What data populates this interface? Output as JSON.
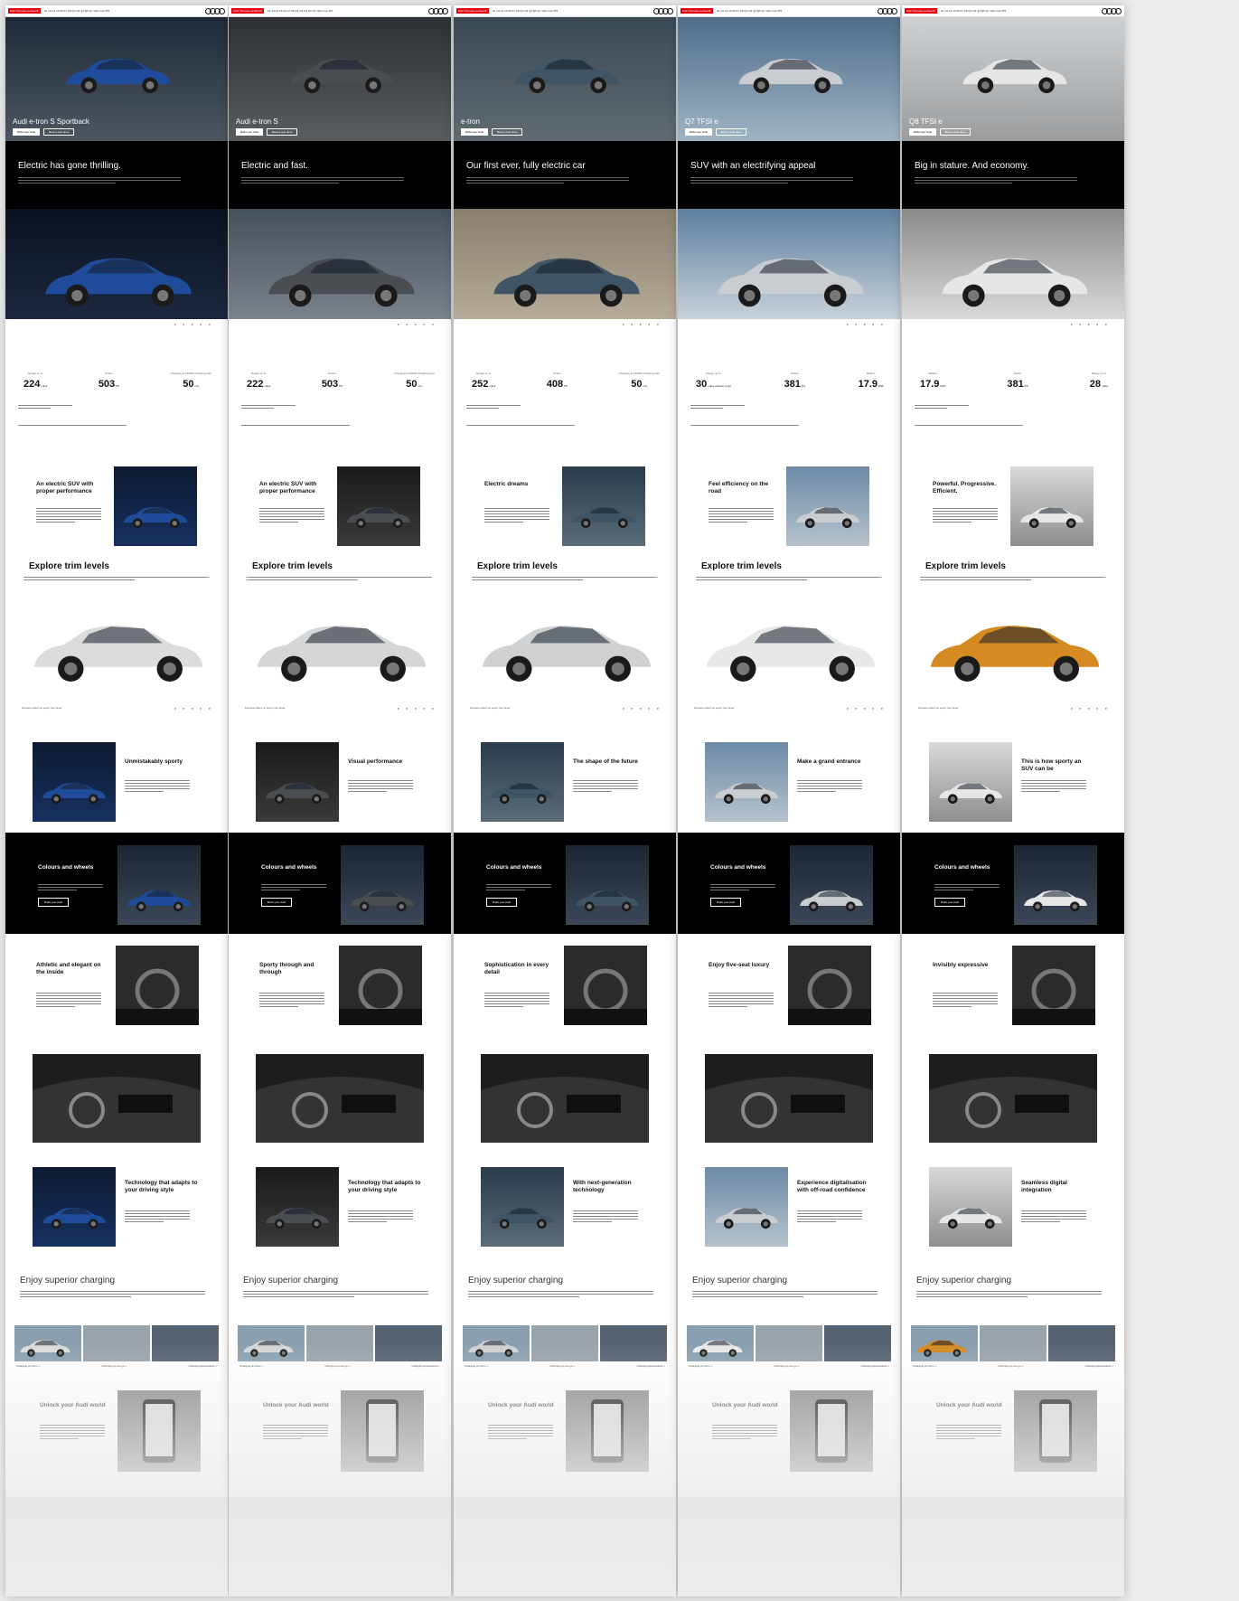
{
  "nav": {
    "badge": "Audi Chooses Authentic",
    "links": "A1 A3 A4 A5 A6 A7 A8 Q2 Q3 Q4 Q5 Q7 Q8 e-tron RS"
  },
  "buttons": {
    "build": "Build your Audi",
    "book": "Book a test drive",
    "colours": "Build your Audi"
  },
  "labels": {
    "trim_title": "Explore trim levels",
    "colours_title": "Colours and wheels",
    "charge_title": "Enjoy superior charging",
    "app_title": "Unlock your Audi world",
    "tile1": "Charging at home  >",
    "tile2": "Charging on the go  >",
    "tile3": "Charging accessories  >",
    "trim_foot": "Finance offers on every trim level"
  },
  "pages": [
    {
      "hero_title": "Audi e-tron S Sportback",
      "headline": "Electric has gone thrilling.",
      "specs": [
        {
          "label": "Range up to",
          "value": "224",
          "unit": "miles"
        },
        {
          "label": "Power",
          "value": "503",
          "unit": "PS"
        },
        {
          "label": "Charging at 150kW charging point",
          "value": "50",
          "unit": "min"
        }
      ],
      "feat1": "An electric SUV with proper performance",
      "feat2": "Unmistakably sporty",
      "feat3": "Athletic and elegant on the inside",
      "feat4": "Technology that adapts to your driving style"
    },
    {
      "hero_title": "Audi e-tron S",
      "headline": "Electric and fast.",
      "specs": [
        {
          "label": "Range up to",
          "value": "222",
          "unit": "miles"
        },
        {
          "label": "Power",
          "value": "503",
          "unit": "PS"
        },
        {
          "label": "Charging at 150kW charging point",
          "value": "50",
          "unit": "min"
        }
      ],
      "feat1": "An electric SUV with proper performance",
      "feat2": "Visual performance",
      "feat3": "Sporty through and through",
      "feat4": "Technology that adapts to your driving style"
    },
    {
      "hero_title": "e-tron",
      "headline": "Our first ever, fully electric car",
      "specs": [
        {
          "label": "Range up to",
          "value": "252",
          "unit": "miles"
        },
        {
          "label": "Power",
          "value": "408",
          "unit": "PS"
        },
        {
          "label": "Charging at 150kW charging point",
          "value": "50",
          "unit": "min"
        }
      ],
      "feat1": "Electric dreams",
      "feat2": "The shape of the future",
      "feat3": "Sophistication in every detail",
      "feat4": "With next-generation technology"
    },
    {
      "hero_title": "Q7 TFSI e",
      "headline": "SUV with an electrifying appeal",
      "specs": [
        {
          "label": "Range up to",
          "value": "30",
          "unit": "miles (electric only)"
        },
        {
          "label": "Power",
          "value": "381",
          "unit": "PS"
        },
        {
          "label": "Battery",
          "value": "17.9",
          "unit": "kWh"
        }
      ],
      "feat1": "Feel efficiency on the road",
      "feat2": "Make a grand entrance",
      "feat3": "Enjoy five-seat luxury",
      "feat4": "Experience digitalisation with off-road confidence"
    },
    {
      "hero_title": "Q8 TFSI e",
      "headline": "Big in stature. And economy.",
      "specs": [
        {
          "label": "Battery",
          "value": "17.9",
          "unit": "kWh"
        },
        {
          "label": "Power",
          "value": "381",
          "unit": "PS"
        },
        {
          "label": "Range up to",
          "value": "28",
          "unit": "miles"
        }
      ],
      "feat1": "Powerful. Progressive. Efficient.",
      "feat2": "This is how sporty an SUV can be",
      "feat3": "Invisibly expressive",
      "feat4": "Seamless digital integration"
    }
  ],
  "colors": {
    "accent": "#e30613",
    "black": "#000000",
    "car_colors": [
      "#1e4c9a",
      "#4a4d52",
      "#3f5565",
      "#c9ccd0",
      "#e6e6e6"
    ],
    "trim_colors": [
      "#dcdcdc",
      "#d4d6d8",
      "#cfd1d3",
      "#e8e8e8",
      "#d58a22"
    ]
  }
}
